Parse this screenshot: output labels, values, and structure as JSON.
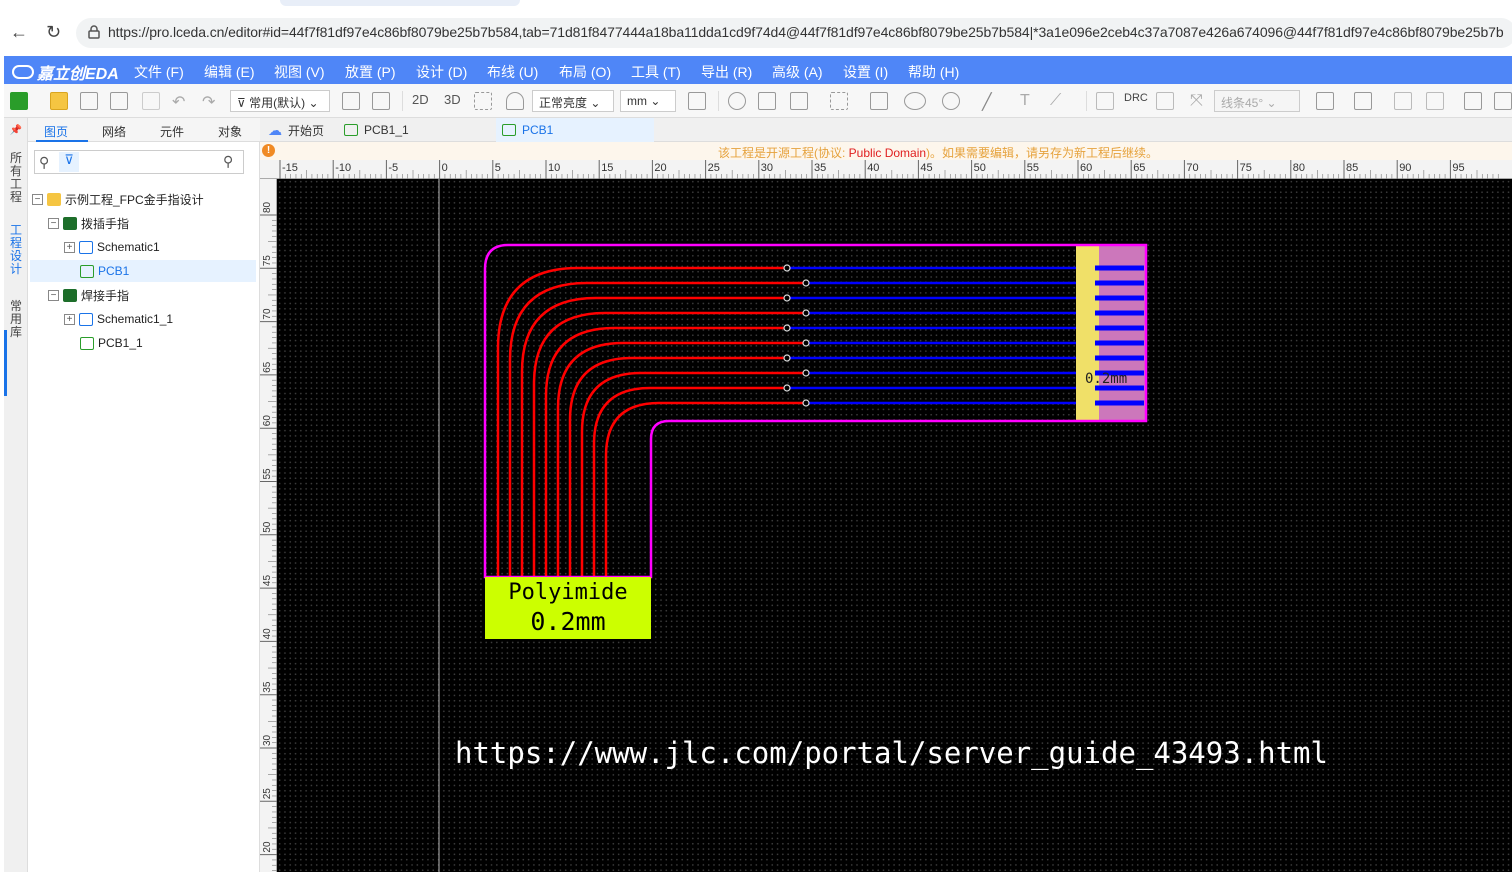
{
  "browser": {
    "url": "https://pro.lceda.cn/editor#id=44f7f81df97e4c86bf8079be25b7b584,tab=71d81f8477444a18ba11dda1cd9f74d4@44f7f81df97e4c86bf8079be25b7b584|*3a1e096e2ceb4c37a7087e426a674096@44f7f81df97e4c86bf8079be25b7b"
  },
  "app": {
    "logo_text": "嘉立创EDA"
  },
  "menu": [
    "文件 (F)",
    "编辑 (E)",
    "视图 (V)",
    "放置 (P)",
    "设计 (D)",
    "布线 (U)",
    "布局 (O)",
    "工具 (T)",
    "导出 (R)",
    "高级 (A)",
    "设置 (I)",
    "帮助 (H)"
  ],
  "toolbar": {
    "filter_select": "常用(默认)",
    "view_2d": "2D",
    "view_3d": "3D",
    "brightness_select": "正常亮度",
    "unit_select": "mm",
    "drc_label": "DRC",
    "line_angle_select": "线条45°"
  },
  "left_tabs": {
    "all_projects": "所有工程",
    "project_design": "工程设计",
    "common_library": "常用库"
  },
  "panel": {
    "tabs": [
      "图页",
      "网络",
      "元件",
      "对象"
    ],
    "search_placeholder": "",
    "tree": {
      "project": "示例工程_FPC金手指设计",
      "board1": "拨插手指",
      "board1_schematic": "Schematic1",
      "board1_pcb": "PCB1",
      "board2": "焊接手指",
      "board2_schematic": "Schematic1_1",
      "board2_pcb": "PCB1_1"
    }
  },
  "doc_tabs": {
    "start": "开始页",
    "tab1": "PCB1_1",
    "tab2": "PCB1"
  },
  "notice": {
    "prefix": "该工程是开源工程(协议: ",
    "license": "Public Domain",
    "suffix": ")。如果需要编辑，请另存为新工程后继续。"
  },
  "ruler": {
    "h_labels": [
      "-15",
      "-10",
      "-5",
      "0",
      "5",
      "10",
      "15",
      "20",
      "25",
      "30",
      "35",
      "40",
      "45",
      "50",
      "55",
      "60",
      "65",
      "70",
      "75",
      "80",
      "85",
      "90",
      "95"
    ],
    "v_labels": [
      "80",
      "75",
      "70",
      "65",
      "60",
      "55",
      "50",
      "45",
      "40",
      "35",
      "30",
      "25",
      "20"
    ]
  },
  "pcb": {
    "label_line1": "Polyimide",
    "label_line2": "0.2mm",
    "finger_label": "0.2mm",
    "trace_count": 10,
    "colors": {
      "outline": "#ff00ff",
      "top_trace": "#ff0000",
      "bottom_trace": "#0000ff",
      "stiffener": "#f0e068",
      "pad_area": "#cc77bb",
      "label_bg": "#ccff00"
    }
  },
  "watermark_url": "https://www.jlc.com/portal/server_guide_43493.html"
}
